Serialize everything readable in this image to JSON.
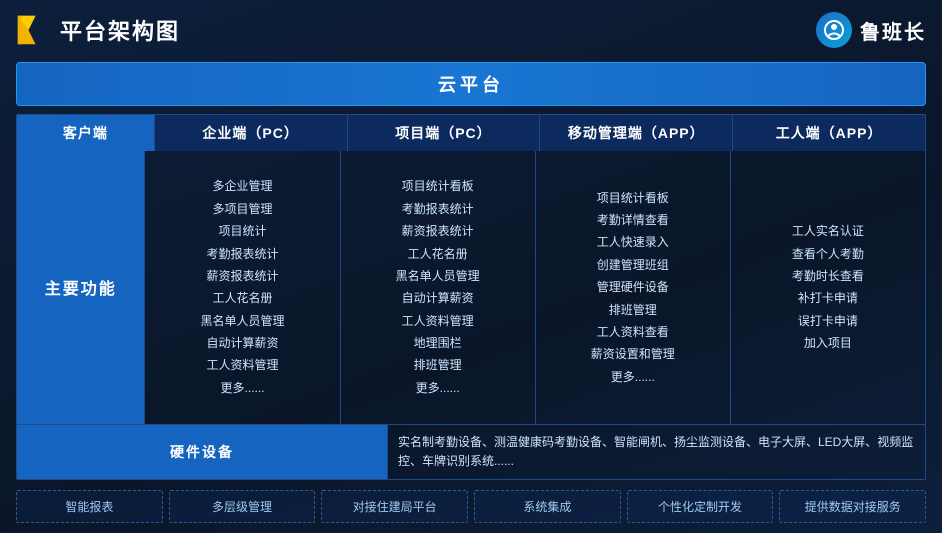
{
  "header": {
    "title": "平台架构图",
    "brand_name": "鲁班长"
  },
  "cloud_banner": "云平台",
  "table": {
    "header": {
      "client_label": "客户端",
      "enterprise_pc": "企业端（PC）",
      "project_pc": "项目端（PC）",
      "mobile_app": "移动管理端（APP）",
      "worker_app": "工人端（APP）"
    },
    "row_label": "主要功能",
    "enterprise_items": [
      "多企业管理",
      "多项目管理",
      "项目统计",
      "考勤报表统计",
      "薪资报表统计",
      "工人花名册",
      "黑名单人员管理",
      "自动计算薪资",
      "工人资料管理",
      "更多......"
    ],
    "project_items": [
      "项目统计看板",
      "考勤报表统计",
      "薪资报表统计",
      "工人花名册",
      "黑名单人员管理",
      "自动计算薪资",
      "工人资料管理",
      "地理围栏",
      "排班管理",
      "更多......"
    ],
    "mobile_items": [
      "项目统计看板",
      "考勤详情查看",
      "工人快速录入",
      "创建管理班组",
      "管理硬件设备",
      "排班管理",
      "工人资料查看",
      "薪资设置和管理",
      "更多......"
    ],
    "worker_items": [
      "工人实名认证",
      "查看个人考勤",
      "考勤时长查看",
      "补打卡申请",
      "误打卡申请",
      "加入项目"
    ]
  },
  "hardware": {
    "label": "硬件设备",
    "content": "实名制考勤设备、测温健康码考勤设备、智能闸机、扬尘监测设备、电子大屏、LED大屏、视频监控、车牌识别系统......"
  },
  "features": [
    "智能报表",
    "多层级管理",
    "对接住建局平台",
    "系统集成",
    "个性化定制开发",
    "提供数据对接服务"
  ]
}
